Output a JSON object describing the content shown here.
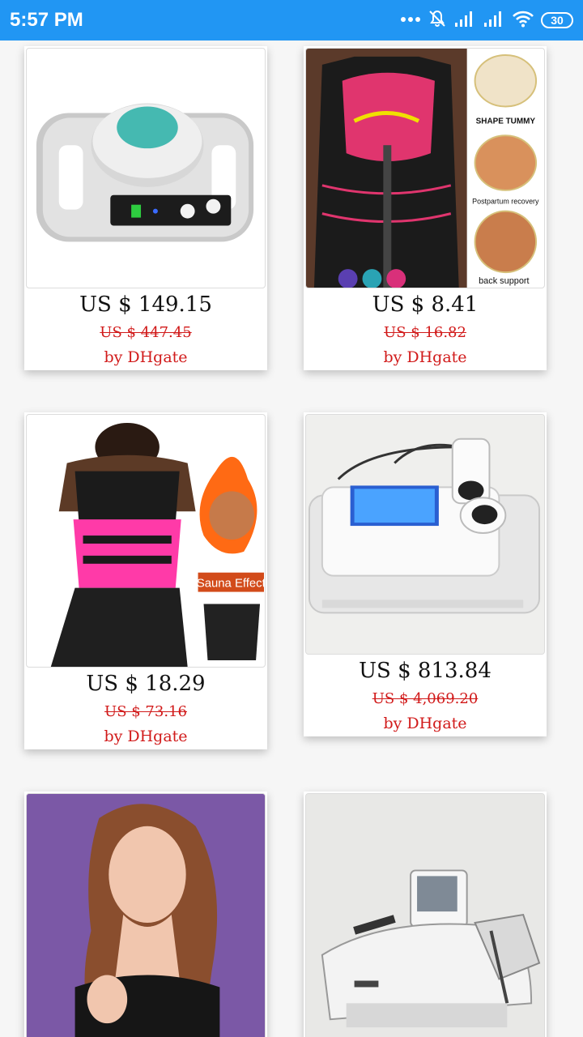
{
  "status_bar": {
    "time": "5:57 PM",
    "battery": "30",
    "icons": [
      "more-dots-icon",
      "notifications-off-icon",
      "signal-icon",
      "signal-icon",
      "wifi-icon",
      "battery-icon"
    ],
    "background_color": "#2196f3"
  },
  "products": [
    {
      "price": "US $ 149.15",
      "old_price": "US $ 447.45",
      "seller": "by DHgate",
      "image": "cooling-device-image"
    },
    {
      "price": "US $ 8.41",
      "old_price": "US $ 16.82",
      "seller": "by DHgate",
      "image": "waist-trainer-vest-image",
      "image_text": [
        "SHAPE TUMMY",
        "Postpartum recovery",
        "back support"
      ]
    },
    {
      "price": "US $ 18.29",
      "old_price": "US $ 73.16",
      "seller": "by DHgate",
      "image": "sauna-waist-belt-image",
      "image_text": [
        "Sauna Effect"
      ]
    },
    {
      "price": "US $ 813.84",
      "old_price": "US $ 4,069.20",
      "seller": "by DHgate",
      "image": "hifu-machine-image"
    },
    {
      "image": "model-portrait-image"
    },
    {
      "image": "shockwave-machine-image"
    }
  ],
  "colors": {
    "price": "#111111",
    "old_price": "#d11a1a",
    "seller": "#d11a1a"
  }
}
